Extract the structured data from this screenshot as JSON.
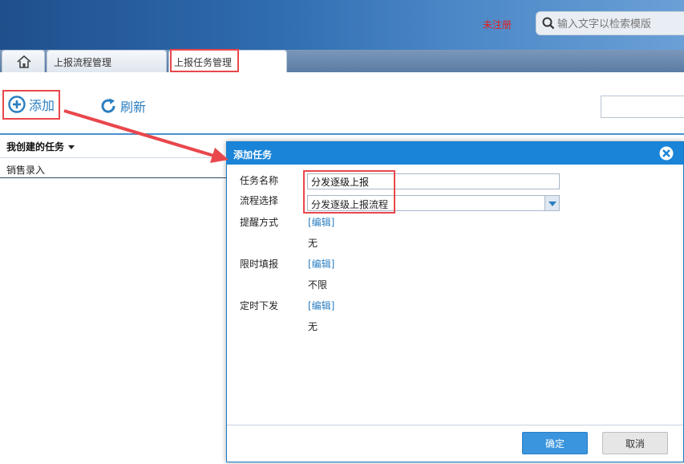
{
  "header": {
    "status_text": "未注册",
    "search_placeholder": "输入文字以检索模版"
  },
  "tabs": [
    {
      "label": "首页",
      "icon": "home-icon"
    },
    {
      "label": "上报流程管理"
    },
    {
      "label": "上报任务管理",
      "active": true
    }
  ],
  "toolbar": {
    "add_label": "添加",
    "refresh_label": "刷新"
  },
  "list": {
    "header": "我创建的任务",
    "rows": [
      "销售录入"
    ]
  },
  "dialog": {
    "title": "添加任务",
    "fields": {
      "task_name_label": "任务名称",
      "task_name_value": "分发逐级上报",
      "process_label": "流程选择",
      "process_value": "分发逐级上报流程",
      "reminder_label": "提醒方式",
      "reminder_edit": "[编辑]",
      "reminder_value": "无",
      "time_limit_label": "限时填报",
      "time_limit_edit": "[编辑]",
      "time_limit_value": "不限",
      "scheduled_label": "定时下发",
      "scheduled_edit": "[编辑]",
      "scheduled_value": "无"
    },
    "ok_label": "确定",
    "cancel_label": "取消"
  },
  "colors": {
    "accent": "#1a84d8",
    "annotation": "#e8474c",
    "link": "#2b7fc1",
    "status": "#e02020"
  }
}
